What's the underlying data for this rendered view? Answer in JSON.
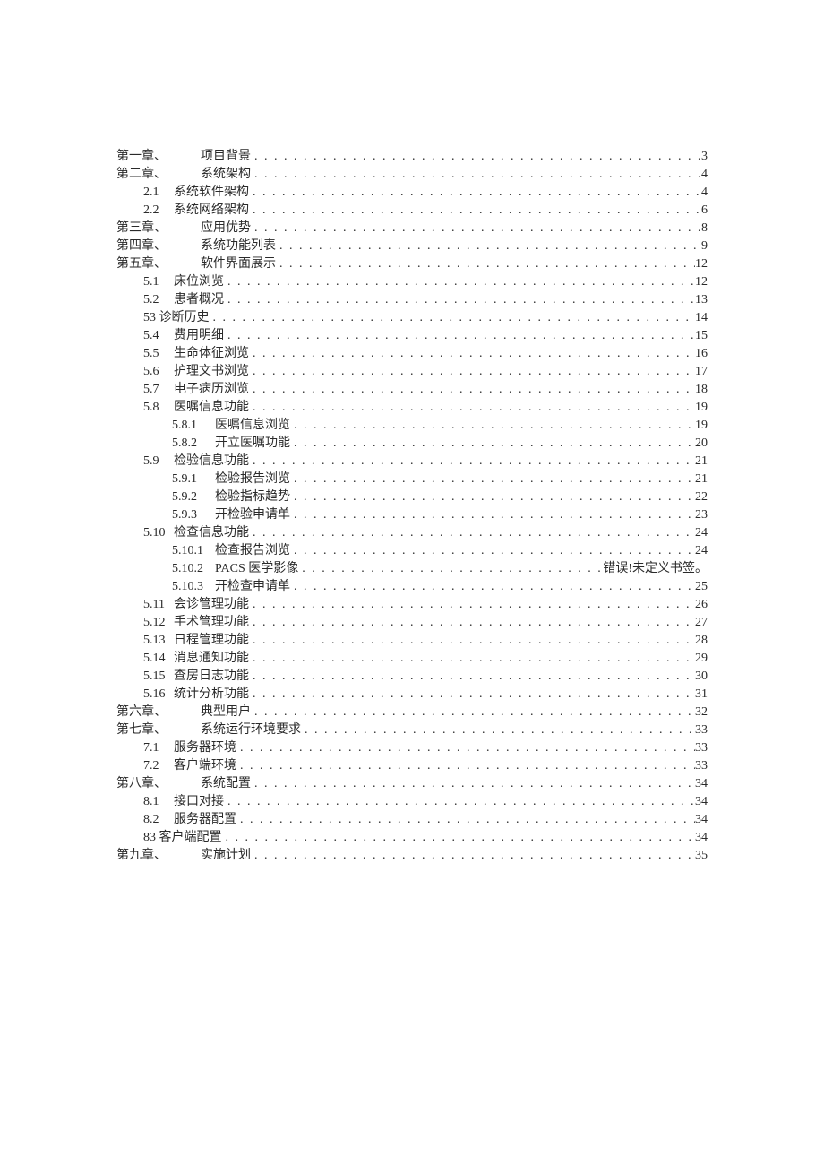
{
  "toc": [
    {
      "level": 0,
      "num": "第一章、",
      "title": "项目背景",
      "page": "3",
      "type": "chapter"
    },
    {
      "level": 0,
      "num": "第二章、",
      "title": "系统架构",
      "page": "4",
      "type": "chapter"
    },
    {
      "level": 1,
      "num": "2.1",
      "title": "系统软件架构",
      "page": "4",
      "type": "section"
    },
    {
      "level": 1,
      "num": "2.2",
      "title": "系统网络架构",
      "page": "6",
      "type": "section"
    },
    {
      "level": 0,
      "num": "第三章、",
      "title": "应用优势",
      "page": "8",
      "type": "chapter"
    },
    {
      "level": 0,
      "num": "第四章、",
      "title": "系统功能列表",
      "page": "9",
      "type": "chapter"
    },
    {
      "level": 0,
      "num": "第五章、",
      "title": "软件界面展示",
      "page": "12",
      "type": "chapter"
    },
    {
      "level": 1,
      "num": "5.1",
      "title": "床位浏览",
      "page": "12",
      "type": "section"
    },
    {
      "level": 1,
      "num": "5.2",
      "title": "患者概况",
      "page": "13",
      "type": "section"
    },
    {
      "level": 1,
      "num": "53",
      "title": "诊断历史",
      "page": "14",
      "type": "section-nomargin"
    },
    {
      "level": 1,
      "num": "5.4",
      "title": "费用明细",
      "page": "15",
      "type": "section"
    },
    {
      "level": 1,
      "num": "5.5",
      "title": "生命体征浏览",
      "page": "16",
      "type": "section"
    },
    {
      "level": 1,
      "num": "5.6",
      "title": "护理文书浏览",
      "page": "17",
      "type": "section"
    },
    {
      "level": 1,
      "num": "5.7",
      "title": "电子病历浏览",
      "page": "18",
      "type": "section"
    },
    {
      "level": 1,
      "num": "5.8",
      "title": "医嘱信息功能",
      "page": "19",
      "type": "section"
    },
    {
      "level": 2,
      "num": "5.8.1",
      "title": "医嘱信息浏览",
      "page": "19",
      "type": "sub"
    },
    {
      "level": 2,
      "num": "5.8.2",
      "title": "开立医嘱功能",
      "page": "20",
      "type": "sub"
    },
    {
      "level": 1,
      "num": "5.9",
      "title": "检验信息功能",
      "page": "21",
      "type": "section"
    },
    {
      "level": 2,
      "num": "5.9.1",
      "title": "检验报告浏览",
      "page": "21",
      "type": "sub"
    },
    {
      "level": 2,
      "num": "5.9.2",
      "title": "检验指标趋势",
      "page": "22",
      "type": "sub"
    },
    {
      "level": 2,
      "num": "5.9.3",
      "title": "开检验申请单",
      "page": "23",
      "type": "sub"
    },
    {
      "level": 1,
      "num": "5.10",
      "title": "检查信息功能",
      "page": "24",
      "type": "section"
    },
    {
      "level": 2,
      "num": "5.10.1",
      "title": "检查报告浏览",
      "page": "24",
      "type": "sub"
    },
    {
      "level": 2,
      "num": "5.10.2",
      "title": "PACS 医学影像",
      "page": "错误!未定义书签。",
      "type": "sub"
    },
    {
      "level": 2,
      "num": "5.10.3",
      "title": "开检查申请单",
      "page": "25",
      "type": "sub"
    },
    {
      "level": 1,
      "num": "5.11",
      "title": "会诊管理功能",
      "page": "26",
      "type": "section"
    },
    {
      "level": 1,
      "num": "5.12",
      "title": "手术管理功能",
      "page": "27",
      "type": "section"
    },
    {
      "level": 1,
      "num": "5.13",
      "title": "日程管理功能",
      "page": "28",
      "type": "section"
    },
    {
      "level": 1,
      "num": "5.14",
      "title": "消息通知功能",
      "page": "29",
      "type": "section"
    },
    {
      "level": 1,
      "num": "5.15",
      "title": "查房日志功能",
      "page": "30",
      "type": "section"
    },
    {
      "level": 1,
      "num": "5.16",
      "title": "统计分析功能",
      "page": "31",
      "type": "section"
    },
    {
      "level": 0,
      "num": "第六章、",
      "title": "典型用户",
      "page": "32",
      "type": "chapter"
    },
    {
      "level": 0,
      "num": "第七章、",
      "title": "系统运行环境要求",
      "page": "33",
      "type": "chapter"
    },
    {
      "level": 1,
      "num": "7.1",
      "title": "服务器环境",
      "page": "33",
      "type": "section"
    },
    {
      "level": 1,
      "num": "7.2",
      "title": "客户端环境",
      "page": "33",
      "type": "section"
    },
    {
      "level": 0,
      "num": "第八章、",
      "title": "系统配置",
      "page": "34",
      "type": "chapter"
    },
    {
      "level": 1,
      "num": "8.1",
      "title": "接口对接",
      "page": "34",
      "type": "section"
    },
    {
      "level": 1,
      "num": "8.2",
      "title": "服务器配置",
      "page": "34",
      "type": "section"
    },
    {
      "level": 1,
      "num": "83",
      "title": "客户端配置",
      "page": "34",
      "type": "section-nomargin"
    },
    {
      "level": 0,
      "num": "第九章、",
      "title": "实施计划",
      "page": "35",
      "type": "chapter"
    }
  ]
}
